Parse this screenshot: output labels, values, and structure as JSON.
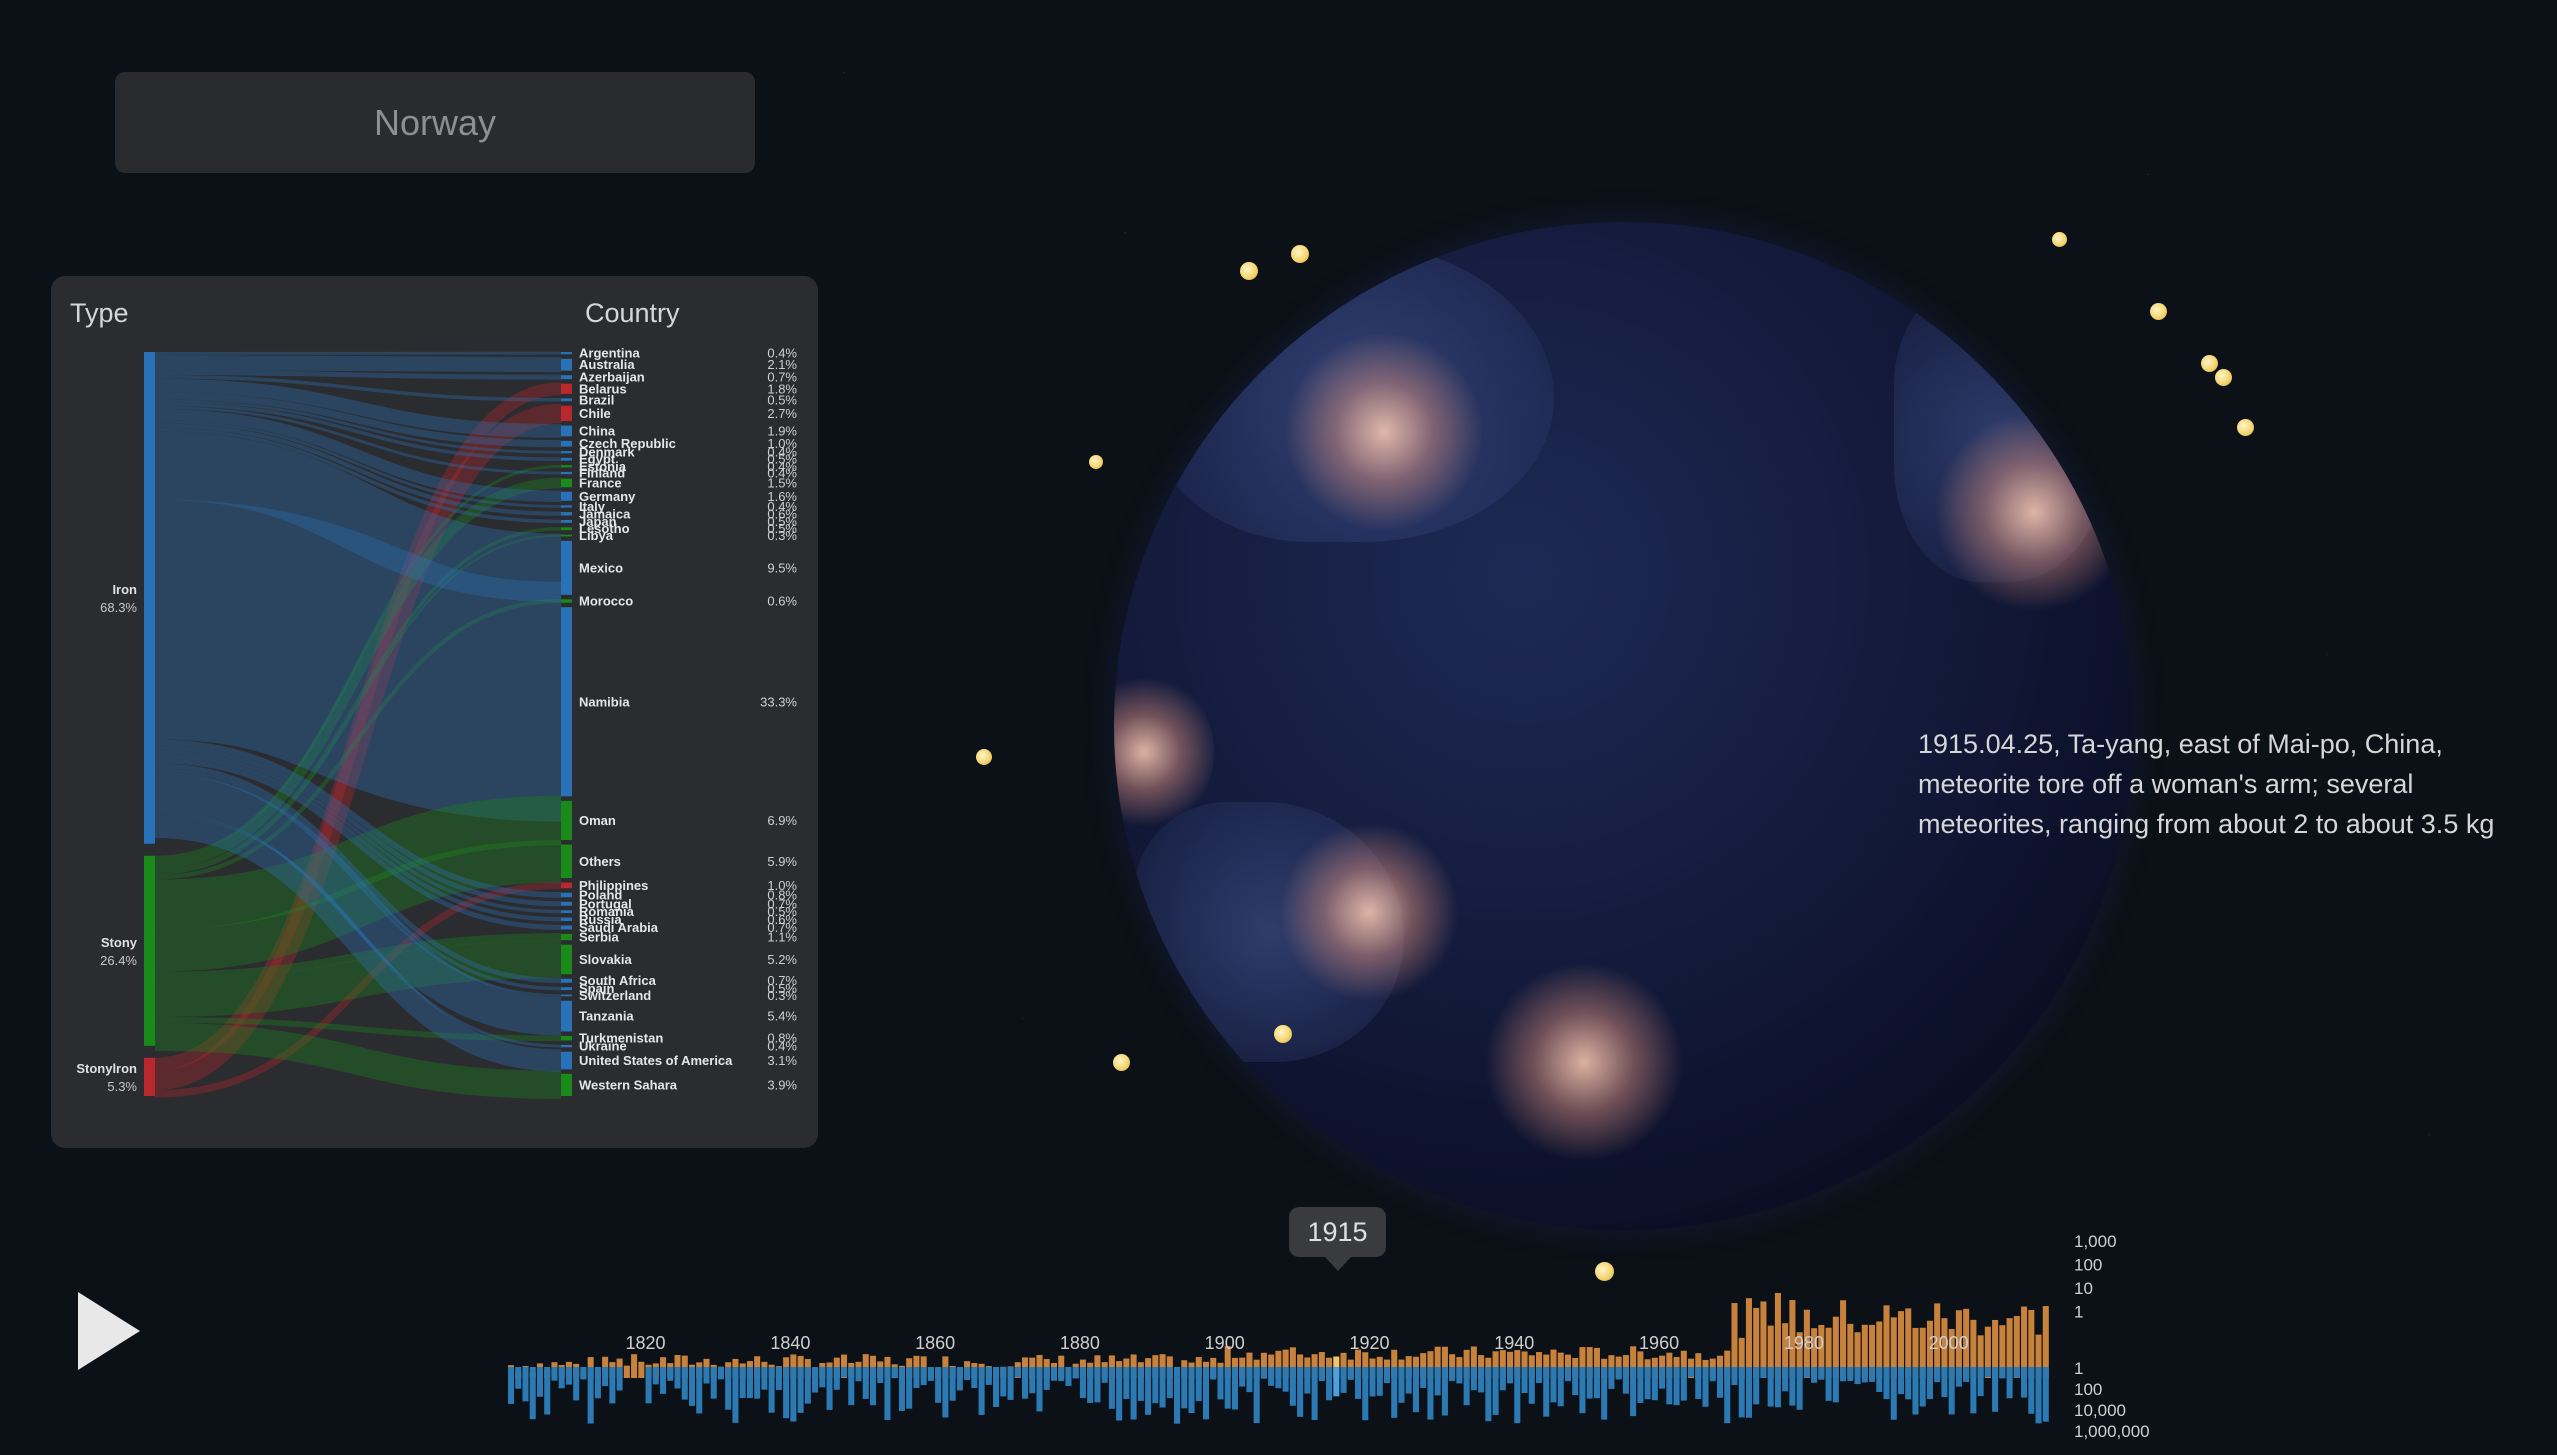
{
  "header": {
    "country_label": "Norway"
  },
  "sankey": {
    "type_heading": "Type",
    "country_heading": "Country",
    "types": [
      {
        "name": "Iron",
        "pct": "68.3%",
        "color": "#2a72b8"
      },
      {
        "name": "Stony",
        "pct": "26.4%",
        "color": "#1a8a1a"
      },
      {
        "name": "Stonylron",
        "pct": "5.3%",
        "color": "#b8282c"
      }
    ],
    "countries": [
      {
        "name": "Argentina",
        "pct": "0.4%",
        "color": "#2a72b8"
      },
      {
        "name": "Australia",
        "pct": "2.1%",
        "color": "#2a72b8"
      },
      {
        "name": "Azerbaijan",
        "pct": "0.7%",
        "color": "#2a72b8"
      },
      {
        "name": "Belarus",
        "pct": "1.8%",
        "color": "#b8282c"
      },
      {
        "name": "Brazil",
        "pct": "0.5%",
        "color": "#2a72b8"
      },
      {
        "name": "Chile",
        "pct": "2.7%",
        "color": "#b8282c"
      },
      {
        "name": "China",
        "pct": "1.9%",
        "color": "#2a72b8"
      },
      {
        "name": "Czech Republic",
        "pct": "1.0%",
        "color": "#2a72b8"
      },
      {
        "name": "Denmark",
        "pct": "0.4%",
        "color": "#2a72b8"
      },
      {
        "name": "Egypt",
        "pct": "0.5%",
        "color": "#2a72b8"
      },
      {
        "name": "Estonia",
        "pct": "0.4%",
        "color": "#1a8a1a"
      },
      {
        "name": "Finland",
        "pct": "0.4%",
        "color": "#2a72b8"
      },
      {
        "name": "France",
        "pct": "1.5%",
        "color": "#1a8a1a"
      },
      {
        "name": "Germany",
        "pct": "1.6%",
        "color": "#2a72b8"
      },
      {
        "name": "Italy",
        "pct": "0.4%",
        "color": "#2a72b8"
      },
      {
        "name": "Jamaica",
        "pct": "0.6%",
        "color": "#2a72b8"
      },
      {
        "name": "Japan",
        "pct": "0.5%",
        "color": "#2a72b8"
      },
      {
        "name": "Lesotho",
        "pct": "0.5%",
        "color": "#1a8a1a"
      },
      {
        "name": "Libya",
        "pct": "0.3%",
        "color": "#1a8a1a"
      },
      {
        "name": "Mexico",
        "pct": "9.5%",
        "color": "#2a72b8"
      },
      {
        "name": "Morocco",
        "pct": "0.6%",
        "color": "#1a8a1a"
      },
      {
        "name": "Namibia",
        "pct": "33.3%",
        "color": "#2a72b8"
      },
      {
        "name": "Oman",
        "pct": "6.9%",
        "color": "#1a8a1a"
      },
      {
        "name": "Others",
        "pct": "5.9%",
        "color": "#1a8a1a"
      },
      {
        "name": "Philippines",
        "pct": "1.0%",
        "color": "#b8282c"
      },
      {
        "name": "Poland",
        "pct": "0.8%",
        "color": "#2a72b8"
      },
      {
        "name": "Portugal",
        "pct": "0.7%",
        "color": "#2a72b8"
      },
      {
        "name": "Romania",
        "pct": "0.5%",
        "color": "#2a72b8"
      },
      {
        "name": "Russia",
        "pct": "0.6%",
        "color": "#2a72b8"
      },
      {
        "name": "Saudi Arabia",
        "pct": "0.7%",
        "color": "#2a72b8"
      },
      {
        "name": "Serbia",
        "pct": "1.1%",
        "color": "#1a8a1a"
      },
      {
        "name": "Slovakia",
        "pct": "5.2%",
        "color": "#1a8a1a"
      },
      {
        "name": "South Africa",
        "pct": "0.7%",
        "color": "#2a72b8"
      },
      {
        "name": "Spain",
        "pct": "0.5%",
        "color": "#2a72b8"
      },
      {
        "name": "Switzerland",
        "pct": "0.3%",
        "color": "#2a72b8"
      },
      {
        "name": "Tanzania",
        "pct": "5.4%",
        "color": "#2a72b8"
      },
      {
        "name": "Turkmenistan",
        "pct": "0.8%",
        "color": "#1a8a1a"
      },
      {
        "name": "Ukraine",
        "pct": "0.4%",
        "color": "#2a72b8"
      },
      {
        "name": "United States of America",
        "pct": "3.1%",
        "color": "#2a72b8"
      },
      {
        "name": "Western Sahara",
        "pct": "3.9%",
        "color": "#1a8a1a"
      }
    ]
  },
  "story": {
    "text": "1915.04.25, Ta-yang, east of Mai-po, China, meteorite tore off a woman's arm; several meteorites, ranging from about 2 to about 3.5 kg"
  },
  "player": {
    "icon": "play-icon"
  },
  "timeline": {
    "current_year": "1915",
    "year_ticks": [
      "1820",
      "1840",
      "1860",
      "1880",
      "1900",
      "1920",
      "1940",
      "1960",
      "1980",
      "2000"
    ],
    "count_scale_labels": [
      "1,000",
      "100",
      "10",
      "1"
    ],
    "mass_scale_labels": [
      "1",
      "100",
      "10,000",
      "1,000,000"
    ],
    "count_color": "#c9823c",
    "mass_color": "#2c7ab3"
  }
}
